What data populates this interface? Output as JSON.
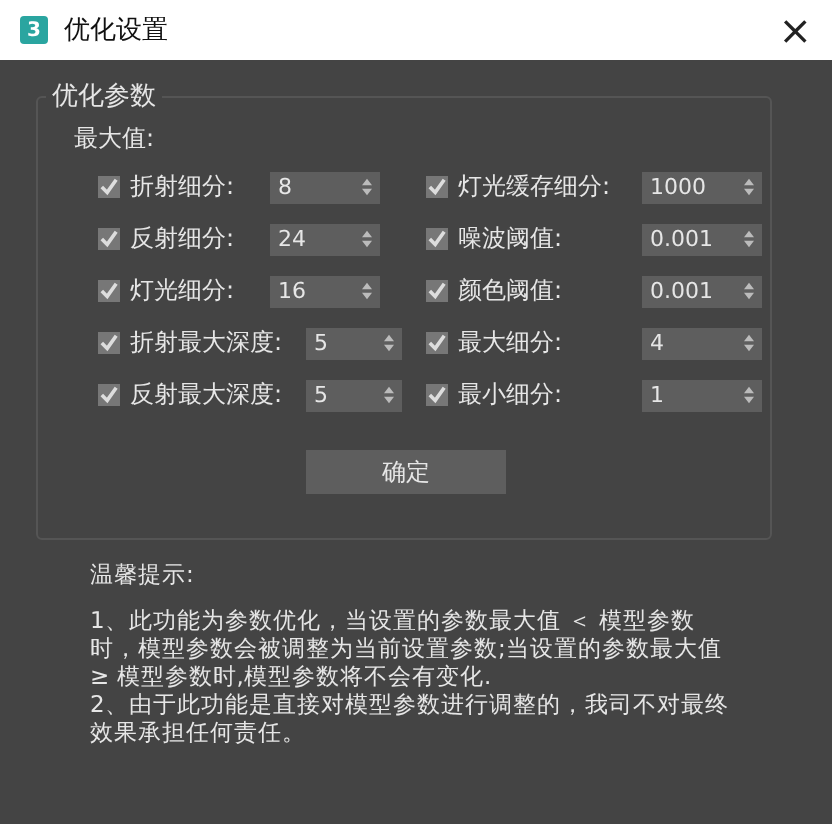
{
  "window": {
    "title": "优化设置",
    "close": "×",
    "app_badge": "3"
  },
  "group": {
    "legend": "优化参数",
    "subtitle": "最大值:",
    "left": [
      {
        "label": "折射细分:",
        "checked": true,
        "value": "8",
        "kind": "short"
      },
      {
        "label": "反射细分:",
        "checked": true,
        "value": "24",
        "kind": "short"
      },
      {
        "label": "灯光细分:",
        "checked": true,
        "value": "16",
        "kind": "short"
      },
      {
        "label": "折射最大深度:",
        "checked": true,
        "value": "5",
        "kind": "long"
      },
      {
        "label": "反射最大深度:",
        "checked": true,
        "value": "5",
        "kind": "long"
      }
    ],
    "right": [
      {
        "label": "灯光缓存细分:",
        "checked": true,
        "value": "1000"
      },
      {
        "label": "噪波阈值:",
        "checked": true,
        "value": "0.001"
      },
      {
        "label": "颜色阈值:",
        "checked": true,
        "value": "0.001"
      },
      {
        "label": "最大细分:",
        "checked": true,
        "value": "4"
      },
      {
        "label": "最小细分:",
        "checked": true,
        "value": "1"
      }
    ],
    "button": "确定"
  },
  "tips": {
    "title": "温馨提示:",
    "lines": [
      "1、此功能为参数优化，当设置的参数最大值 ＜ 模型参数",
      "时，模型参数会被调整为当前设置参数;当设置的参数最大值",
      "≥ 模型参数时,模型参数将不会有变化.",
      "2、由于此功能是直接对模型参数进行调整的，我司不对最终",
      "效果承担任何责任。"
    ]
  }
}
